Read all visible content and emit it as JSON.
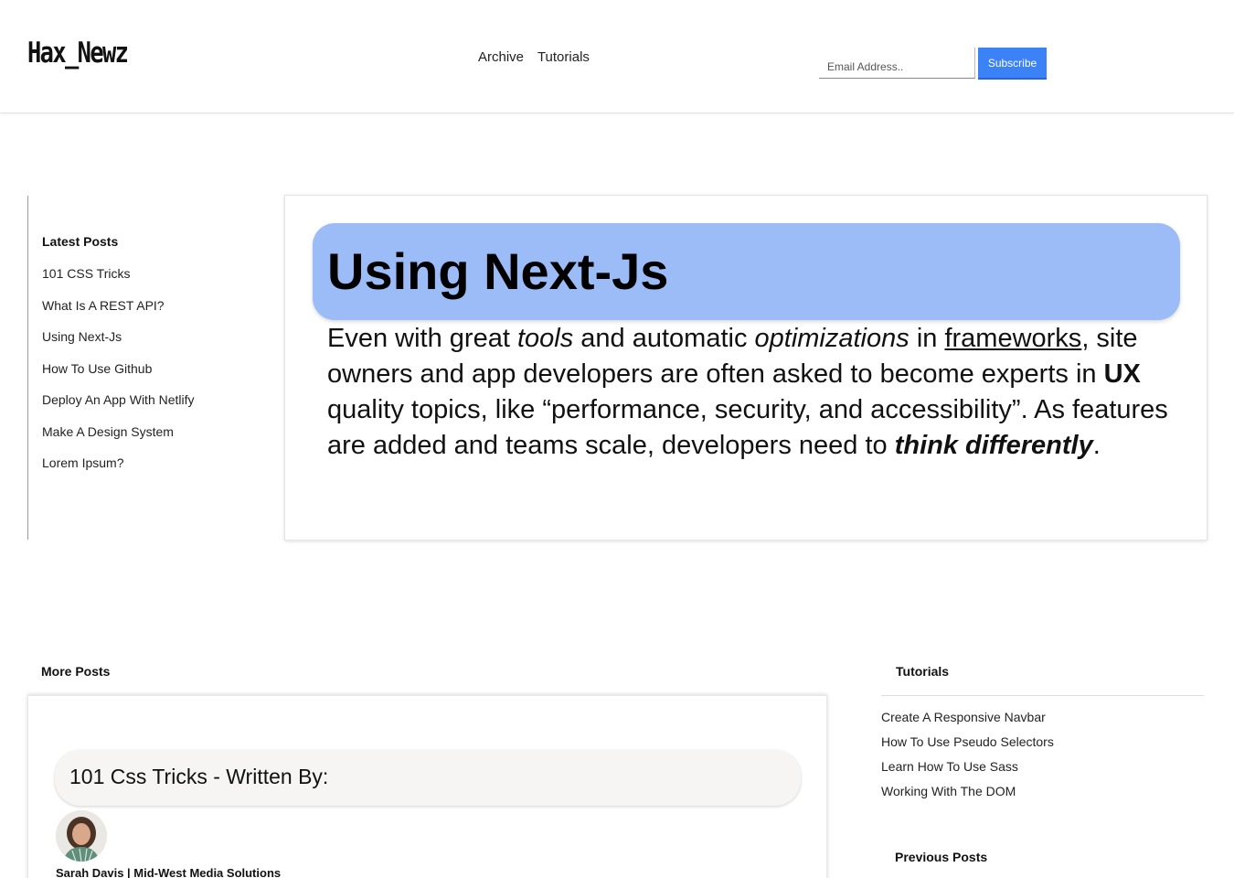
{
  "header": {
    "logo": "Hax_Newz",
    "nav": [
      "Archive",
      "Tutorials"
    ],
    "email_placeholder": "Email Address..",
    "subscribe_label": "Subscribe"
  },
  "latest_posts": {
    "heading": "Latest Posts",
    "items": [
      "101 CSS Tricks",
      "What Is A REST API?",
      "Using Next-Js",
      "How To Use Github",
      "Deploy An App With Netlify",
      "Make A Design System",
      "Lorem Ipsum?"
    ]
  },
  "feature": {
    "title": "Using Next-Js",
    "body": {
      "p1": "Even with great ",
      "e1": "tools",
      "p2": " and automatic ",
      "e2": "optimizations",
      "p3": " in ",
      "link": "frameworks",
      "p4": ", site owners and app developers are often asked to become experts in ",
      "b1": "UX",
      "p5": " quality topics, like “performance, security, and accessibility”. As features are added and teams scale, developers need to ",
      "bi": "think differently",
      "p6": "."
    }
  },
  "more_posts": {
    "heading": "More Posts",
    "post_title": "101 Css Tricks - Written By:",
    "author": "Sarah Davis | Mid-West Media Solutions"
  },
  "tutorials": {
    "heading": "Tutorials",
    "items": [
      "Create A Responsive Navbar",
      "How To Use Pseudo Selectors",
      "Learn How To Use Sass",
      "Working With The DOM"
    ]
  },
  "previous_posts": {
    "heading": "Previous Posts"
  },
  "colors": {
    "accent": "#3b82f6",
    "title_bg": "#9cbcf8",
    "pill_bg": "#f6f5f3"
  }
}
